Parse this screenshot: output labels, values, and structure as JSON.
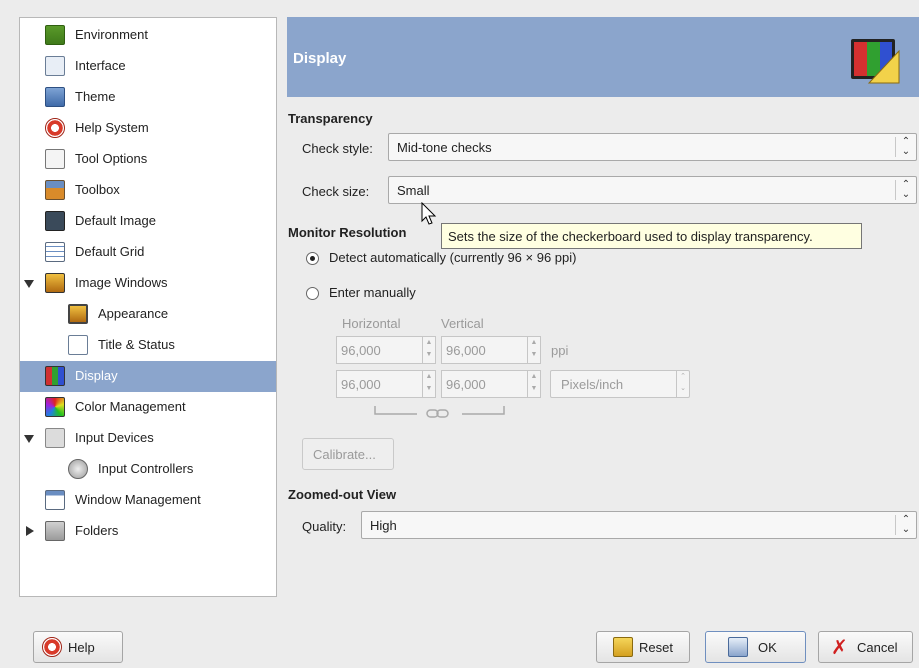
{
  "sidebar": {
    "items": [
      {
        "label": "Environment"
      },
      {
        "label": "Interface"
      },
      {
        "label": "Theme"
      },
      {
        "label": "Help System"
      },
      {
        "label": "Tool Options"
      },
      {
        "label": "Toolbox"
      },
      {
        "label": "Default Image"
      },
      {
        "label": "Default Grid"
      },
      {
        "label": "Image Windows"
      },
      {
        "label": "Appearance"
      },
      {
        "label": "Title & Status"
      },
      {
        "label": "Display"
      },
      {
        "label": "Color Management"
      },
      {
        "label": "Input Devices"
      },
      {
        "label": "Input Controllers"
      },
      {
        "label": "Window Management"
      },
      {
        "label": "Folders"
      }
    ]
  },
  "header": {
    "title": "Display"
  },
  "transparency": {
    "title": "Transparency",
    "check_style_label": "Check style:",
    "check_style_value": "Mid-tone checks",
    "check_size_label": "Check size:",
    "check_size_value": "Small"
  },
  "tooltip": {
    "text": "Sets the size of the checkerboard used to display transparency."
  },
  "monitor": {
    "title": "Monitor Resolution",
    "detect_label": "Detect automatically (currently 96 × 96 ppi)",
    "manual_label": "Enter manually",
    "horizontal_label": "Horizontal",
    "vertical_label": "Vertical",
    "h1": "96,000",
    "v1": "96,000",
    "unit1": "ppi",
    "h2": "96,000",
    "v2": "96,000",
    "unit2": "Pixels/inch",
    "calibrate_label": "Calibrate..."
  },
  "zoomed": {
    "title": "Zoomed-out View",
    "quality_label": "Quality:",
    "quality_value": "High"
  },
  "footer": {
    "help_label": "Help",
    "reset_label": "Reset",
    "ok_label": "OK",
    "cancel_label": "Cancel"
  },
  "colors": {
    "accent": "#8ba5cc",
    "tooltip_bg": "#ffffe1"
  }
}
